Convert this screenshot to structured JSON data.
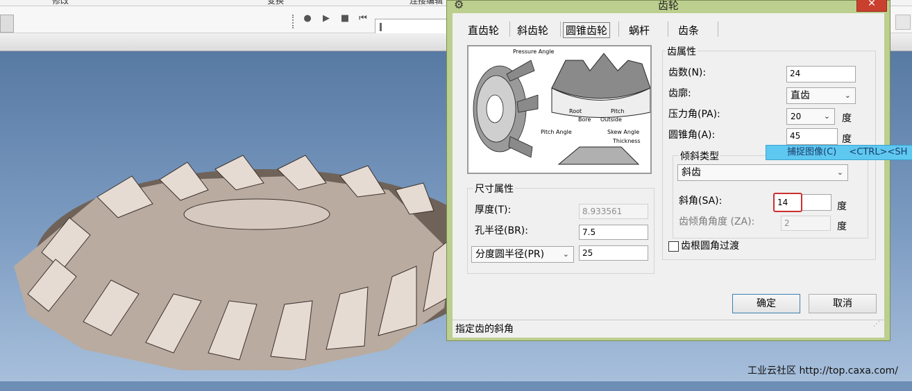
{
  "topbar": {
    "items": [
      "修改",
      "变换",
      "连接编辑"
    ]
  },
  "toolbar": {
    "icons": [
      "record-icon",
      "play-icon",
      "stop-icon",
      "rewind-icon"
    ]
  },
  "viewport": {
    "watermark": "工业云社区 http://top.caxa.com/"
  },
  "context_menu": {
    "label": "捕捉图像(C)",
    "shortcut": "<CTRL><SH"
  },
  "dialog": {
    "title": "齿轮",
    "close_label": "✕",
    "tabs": [
      {
        "label": "直齿轮"
      },
      {
        "label": "斜齿轮"
      },
      {
        "label": "圆锥齿轮",
        "active": true
      },
      {
        "label": "蜗杆"
      },
      {
        "label": "齿条"
      }
    ],
    "diagram_labels": {
      "pressure_angle": "Pressure Angle",
      "root": "Root",
      "pitch": "Pitch",
      "bore": "Bore",
      "outside": "Outside",
      "pitch_angle": "Pitch Angle",
      "skew_angle": "Skew Angle",
      "thickness": "Thickness"
    },
    "size_group": {
      "title": "尺寸属性",
      "thickness_label": "厚度(T):",
      "thickness_value": "8.933561",
      "bore_label": "孔半径(BR):",
      "bore_value": "7.5",
      "pitch_select": "分度圆半径(PR)",
      "pitch_value": "25"
    },
    "tooth_group": {
      "title": "齿属性",
      "count_label": "齿数(N):",
      "count_value": "24",
      "profile_label": "齿廓:",
      "profile_value": "直齿",
      "pa_label": "压力角(PA):",
      "pa_value": "20",
      "pa_unit": "度",
      "cone_label": "圆锥角(A):",
      "cone_value": "45",
      "cone_unit": "度"
    },
    "skew_group": {
      "title": "倾斜类型",
      "type_value": "斜齿",
      "sa_label": "斜角(SA):",
      "sa_value": "14",
      "sa_unit": "度",
      "za_label": "齿倾角角度 (ZA):",
      "za_value": "2",
      "za_unit": "度"
    },
    "fillet_label": "齿根圆角过渡",
    "ok_label": "确定",
    "cancel_label": "取消",
    "status_text": "指定齿的斜角"
  }
}
